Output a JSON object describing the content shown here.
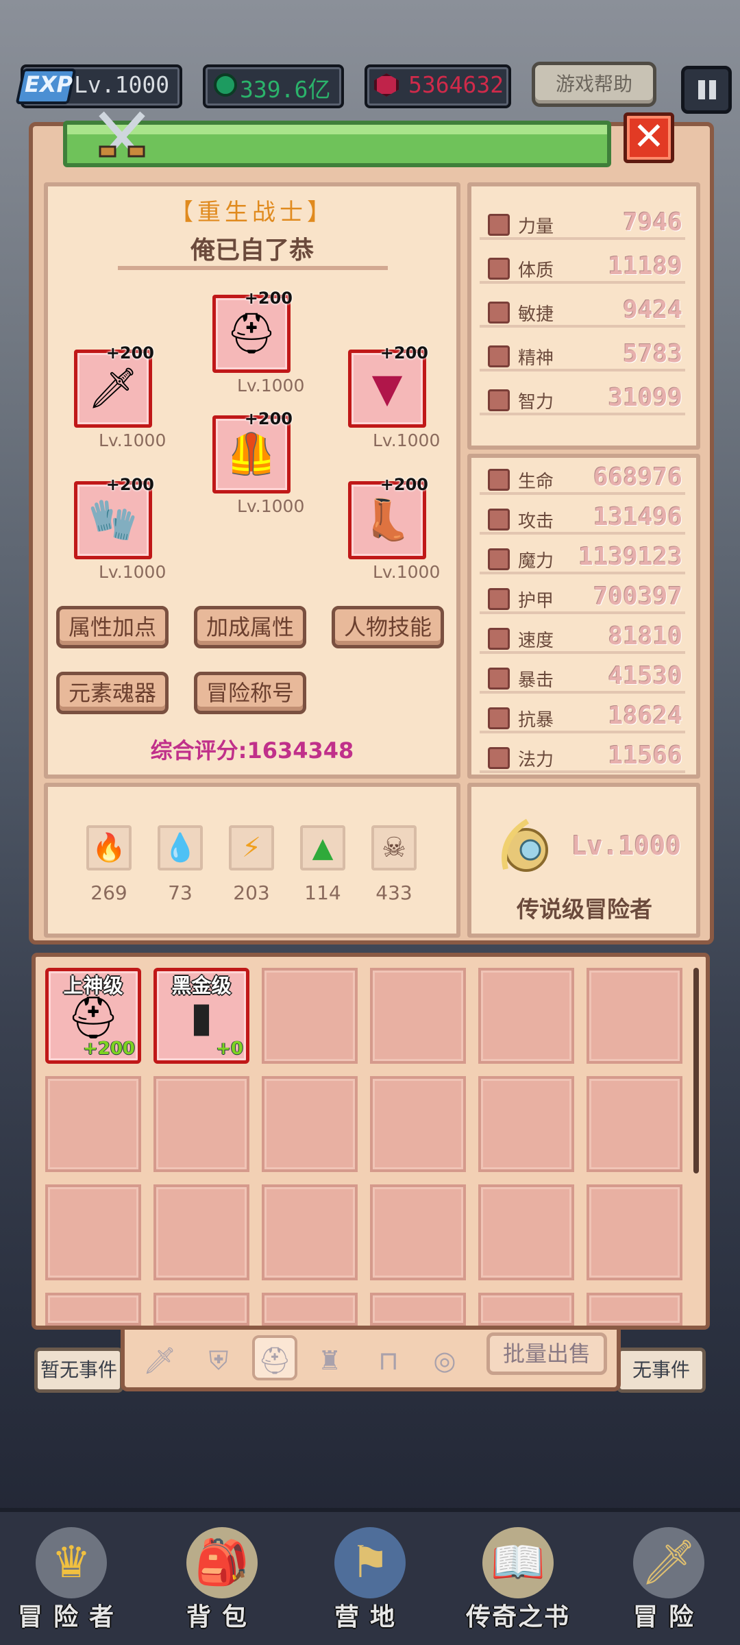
{
  "top_bar": {
    "exp_badge": "EXP",
    "level": "Lv.1000",
    "green_currency": "339.6亿",
    "red_currency": "5364632",
    "help_label": "游戏帮助"
  },
  "character": {
    "class": "【重生战士】",
    "name": "俺已自了恭",
    "score_label": "综合评分:1634348"
  },
  "equipment": [
    {
      "slot": "helmet",
      "plus": "+200",
      "level": "Lv.1000",
      "icon": "helmet-icon"
    },
    {
      "slot": "weapon",
      "plus": "+200",
      "level": "Lv.1000",
      "icon": "sword-icon"
    },
    {
      "slot": "amulet",
      "plus": "+200",
      "level": "Lv.1000",
      "icon": "amulet-icon"
    },
    {
      "slot": "armor",
      "plus": "+200",
      "level": "Lv.1000",
      "icon": "armor-icon"
    },
    {
      "slot": "gloves",
      "plus": "+200",
      "level": "Lv.1000",
      "icon": "gloves-icon"
    },
    {
      "slot": "boots",
      "plus": "+200",
      "level": "Lv.1000",
      "icon": "boots-icon"
    }
  ],
  "buttons": [
    "属性加点",
    "加成属性",
    "人物技能",
    "元素魂器",
    "冒险称号"
  ],
  "base_stats": [
    {
      "label": "力量",
      "value": "7946"
    },
    {
      "label": "体质",
      "value": "11189"
    },
    {
      "label": "敏捷",
      "value": "9424"
    },
    {
      "label": "精神",
      "value": "5783"
    },
    {
      "label": "智力",
      "value": "31099"
    }
  ],
  "combat_stats": [
    {
      "label": "生命",
      "value": "668976"
    },
    {
      "label": "攻击",
      "value": "131496"
    },
    {
      "label": "魔力",
      "value": "1139123"
    },
    {
      "label": "护甲",
      "value": "700397"
    },
    {
      "label": "速度",
      "value": "81810"
    },
    {
      "label": "暴击",
      "value": "41530"
    },
    {
      "label": "抗暴",
      "value": "18624"
    },
    {
      "label": "法力",
      "value": "11566"
    }
  ],
  "elements": [
    {
      "icon": "fire-icon",
      "value": "269"
    },
    {
      "icon": "water-drop-icon",
      "value": "73"
    },
    {
      "icon": "lightning-icon",
      "value": "203"
    },
    {
      "icon": "leaf-icon",
      "value": "114"
    },
    {
      "icon": "skull-icon",
      "value": "433"
    }
  ],
  "rank": {
    "level": "Lv.1000",
    "title": "传说级冒险者"
  },
  "inventory": [
    {
      "tier": "上神级",
      "level": "+200",
      "icon": "helmet-icon"
    },
    {
      "tier": "黑金级",
      "level": "+0",
      "icon": "dark-armor-icon"
    }
  ],
  "tabs": [
    "sword-icon",
    "shield-icon",
    "helmet-icon",
    "armor-icon",
    "pants-icon",
    "ring-icon"
  ],
  "sell_label": "批量出售",
  "side_events": {
    "left": "暂无事件",
    "right": "无事件"
  },
  "nav": [
    {
      "label": "冒险者",
      "icon": "crown-icon"
    },
    {
      "label": "背包",
      "icon": "backpack-icon"
    },
    {
      "label": "营地",
      "icon": "camp-icon"
    },
    {
      "label": "传奇之书",
      "icon": "book-icon"
    },
    {
      "label": "冒险",
      "icon": "sword-icon"
    }
  ]
}
